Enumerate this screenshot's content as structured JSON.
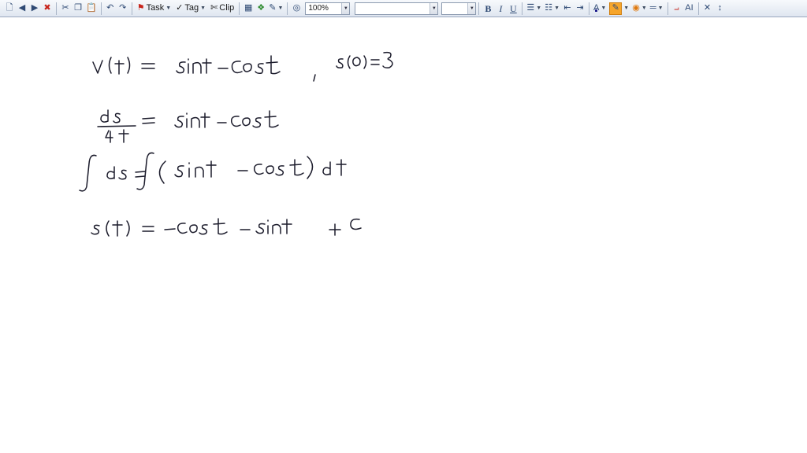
{
  "toolbar": {
    "task_label": "Task",
    "tag_label": "Tag",
    "clip_label": "Clip",
    "zoom_value": "100%",
    "bold_label": "B",
    "italic_label": "I",
    "underline_label": "U",
    "font_color_label": "A",
    "style_label": "AI",
    "icons": [
      "new-page-icon",
      "back-icon",
      "forward-icon",
      "delete-page-icon",
      "cut-icon",
      "copy-icon",
      "paste-icon",
      "undo-icon",
      "redo-icon",
      "task-flag-icon",
      "tag-icon",
      "clip-icon",
      "table-icon",
      "insert-object-icon",
      "pen-icon",
      "link-icon",
      "bulleted-list-icon",
      "numbered-list-icon",
      "decrease-indent-icon",
      "increase-indent-icon",
      "font-color-icon",
      "highlight-icon",
      "fill-color-icon",
      "line-style-icon",
      "eraser-icon",
      "style-icon",
      "close-icon",
      "vertical-space-icon"
    ],
    "colors": {
      "highlight": "#f6a52b",
      "accent_red": "#c8261d",
      "accent_green": "#2e8b2e"
    }
  },
  "canvas": {
    "ink_color": "#1b1b2b",
    "lines": [
      "v(t) = sint - cost , s(0) = 3",
      "ds/dt = sint - cost",
      "∫ds = ∫(sint - cost)dt",
      "s(t) = -cost - sint + C"
    ]
  }
}
